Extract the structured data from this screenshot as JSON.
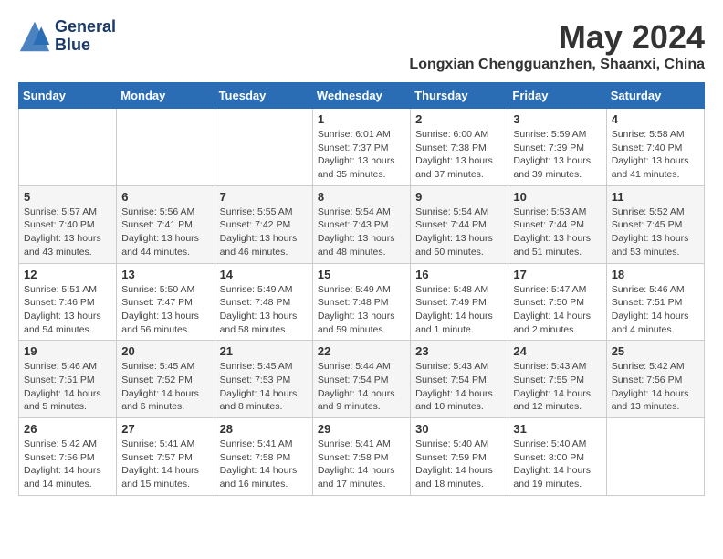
{
  "header": {
    "logo_line1": "General",
    "logo_line2": "Blue",
    "month": "May 2024",
    "location": "Longxian Chengguanzhen, Shaanxi, China"
  },
  "weekdays": [
    "Sunday",
    "Monday",
    "Tuesday",
    "Wednesday",
    "Thursday",
    "Friday",
    "Saturday"
  ],
  "weeks": [
    [
      {
        "day": "",
        "info": ""
      },
      {
        "day": "",
        "info": ""
      },
      {
        "day": "",
        "info": ""
      },
      {
        "day": "1",
        "info": "Sunrise: 6:01 AM\nSunset: 7:37 PM\nDaylight: 13 hours\nand 35 minutes."
      },
      {
        "day": "2",
        "info": "Sunrise: 6:00 AM\nSunset: 7:38 PM\nDaylight: 13 hours\nand 37 minutes."
      },
      {
        "day": "3",
        "info": "Sunrise: 5:59 AM\nSunset: 7:39 PM\nDaylight: 13 hours\nand 39 minutes."
      },
      {
        "day": "4",
        "info": "Sunrise: 5:58 AM\nSunset: 7:40 PM\nDaylight: 13 hours\nand 41 minutes."
      }
    ],
    [
      {
        "day": "5",
        "info": "Sunrise: 5:57 AM\nSunset: 7:40 PM\nDaylight: 13 hours\nand 43 minutes."
      },
      {
        "day": "6",
        "info": "Sunrise: 5:56 AM\nSunset: 7:41 PM\nDaylight: 13 hours\nand 44 minutes."
      },
      {
        "day": "7",
        "info": "Sunrise: 5:55 AM\nSunset: 7:42 PM\nDaylight: 13 hours\nand 46 minutes."
      },
      {
        "day": "8",
        "info": "Sunrise: 5:54 AM\nSunset: 7:43 PM\nDaylight: 13 hours\nand 48 minutes."
      },
      {
        "day": "9",
        "info": "Sunrise: 5:54 AM\nSunset: 7:44 PM\nDaylight: 13 hours\nand 50 minutes."
      },
      {
        "day": "10",
        "info": "Sunrise: 5:53 AM\nSunset: 7:44 PM\nDaylight: 13 hours\nand 51 minutes."
      },
      {
        "day": "11",
        "info": "Sunrise: 5:52 AM\nSunset: 7:45 PM\nDaylight: 13 hours\nand 53 minutes."
      }
    ],
    [
      {
        "day": "12",
        "info": "Sunrise: 5:51 AM\nSunset: 7:46 PM\nDaylight: 13 hours\nand 54 minutes."
      },
      {
        "day": "13",
        "info": "Sunrise: 5:50 AM\nSunset: 7:47 PM\nDaylight: 13 hours\nand 56 minutes."
      },
      {
        "day": "14",
        "info": "Sunrise: 5:49 AM\nSunset: 7:48 PM\nDaylight: 13 hours\nand 58 minutes."
      },
      {
        "day": "15",
        "info": "Sunrise: 5:49 AM\nSunset: 7:48 PM\nDaylight: 13 hours\nand 59 minutes."
      },
      {
        "day": "16",
        "info": "Sunrise: 5:48 AM\nSunset: 7:49 PM\nDaylight: 14 hours\nand 1 minute."
      },
      {
        "day": "17",
        "info": "Sunrise: 5:47 AM\nSunset: 7:50 PM\nDaylight: 14 hours\nand 2 minutes."
      },
      {
        "day": "18",
        "info": "Sunrise: 5:46 AM\nSunset: 7:51 PM\nDaylight: 14 hours\nand 4 minutes."
      }
    ],
    [
      {
        "day": "19",
        "info": "Sunrise: 5:46 AM\nSunset: 7:51 PM\nDaylight: 14 hours\nand 5 minutes."
      },
      {
        "day": "20",
        "info": "Sunrise: 5:45 AM\nSunset: 7:52 PM\nDaylight: 14 hours\nand 6 minutes."
      },
      {
        "day": "21",
        "info": "Sunrise: 5:45 AM\nSunset: 7:53 PM\nDaylight: 14 hours\nand 8 minutes."
      },
      {
        "day": "22",
        "info": "Sunrise: 5:44 AM\nSunset: 7:54 PM\nDaylight: 14 hours\nand 9 minutes."
      },
      {
        "day": "23",
        "info": "Sunrise: 5:43 AM\nSunset: 7:54 PM\nDaylight: 14 hours\nand 10 minutes."
      },
      {
        "day": "24",
        "info": "Sunrise: 5:43 AM\nSunset: 7:55 PM\nDaylight: 14 hours\nand 12 minutes."
      },
      {
        "day": "25",
        "info": "Sunrise: 5:42 AM\nSunset: 7:56 PM\nDaylight: 14 hours\nand 13 minutes."
      }
    ],
    [
      {
        "day": "26",
        "info": "Sunrise: 5:42 AM\nSunset: 7:56 PM\nDaylight: 14 hours\nand 14 minutes."
      },
      {
        "day": "27",
        "info": "Sunrise: 5:41 AM\nSunset: 7:57 PM\nDaylight: 14 hours\nand 15 minutes."
      },
      {
        "day": "28",
        "info": "Sunrise: 5:41 AM\nSunset: 7:58 PM\nDaylight: 14 hours\nand 16 minutes."
      },
      {
        "day": "29",
        "info": "Sunrise: 5:41 AM\nSunset: 7:58 PM\nDaylight: 14 hours\nand 17 minutes."
      },
      {
        "day": "30",
        "info": "Sunrise: 5:40 AM\nSunset: 7:59 PM\nDaylight: 14 hours\nand 18 minutes."
      },
      {
        "day": "31",
        "info": "Sunrise: 5:40 AM\nSunset: 8:00 PM\nDaylight: 14 hours\nand 19 minutes."
      },
      {
        "day": "",
        "info": ""
      }
    ]
  ]
}
